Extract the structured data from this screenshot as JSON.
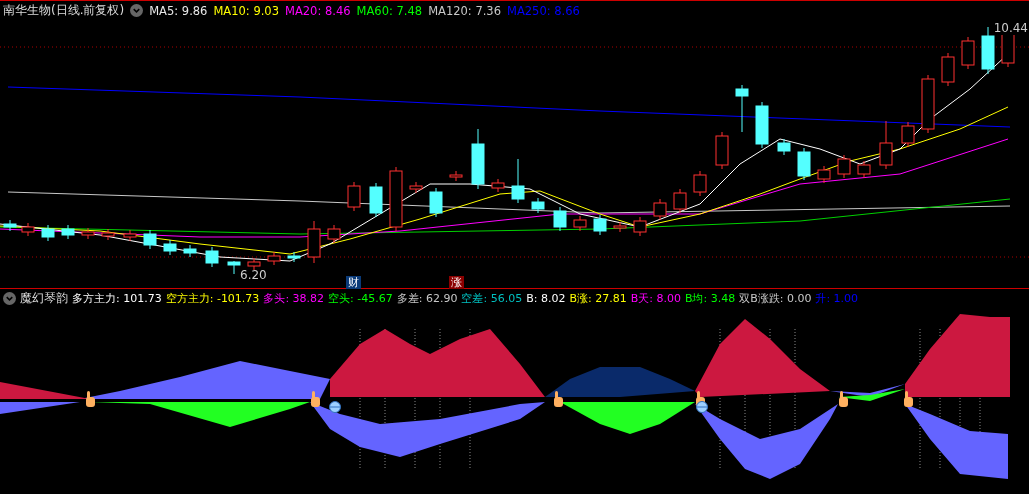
{
  "stock": {
    "title": "南华生物(日线.前复权)"
  },
  "ma_legend": [
    {
      "label": "MA5: 9.86",
      "color": "#e8e8e8"
    },
    {
      "label": "MA10: 9.03",
      "color": "#ffff00"
    },
    {
      "label": "MA20: 8.46",
      "color": "#ff00ff"
    },
    {
      "label": "MA60: 7.48",
      "color": "#00ff00"
    },
    {
      "label": "MA120: 7.36",
      "color": "#c8c8c8"
    },
    {
      "label": "MA250: 8.66",
      "color": "#0000ff"
    }
  ],
  "price_labels": {
    "high": "10.44",
    "low": "6.20"
  },
  "events": [
    {
      "label": "财",
      "color": "#0a3a78"
    },
    {
      "label": "涨",
      "color": "#8a0000"
    }
  ],
  "indicator": {
    "name": "魔幻琴韵",
    "values": [
      {
        "label": "多方主力: 101.73",
        "color": "#ffffff"
      },
      {
        "label": "空方主力: -101.73",
        "color": "#ffff00"
      },
      {
        "label": "多头: 38.82",
        "color": "#ff00ff"
      },
      {
        "label": "空头: -45.67",
        "color": "#00ff00"
      },
      {
        "label": "多差: 62.90",
        "color": "#c8c8c8"
      },
      {
        "label": "空差: 56.05",
        "color": "#00c0c0"
      },
      {
        "label": "B: 8.02",
        "color": "#ffffff"
      },
      {
        "label": "B涨: 27.81",
        "color": "#ffff00"
      },
      {
        "label": "B天: 8.00",
        "color": "#ff00ff"
      },
      {
        "label": "B均: 3.48",
        "color": "#00ff00"
      },
      {
        "label": "双B涨跌: 0.00",
        "color": "#c8c8c8"
      },
      {
        "label": "升: 1.00",
        "color": "#0000ff"
      }
    ]
  }
}
